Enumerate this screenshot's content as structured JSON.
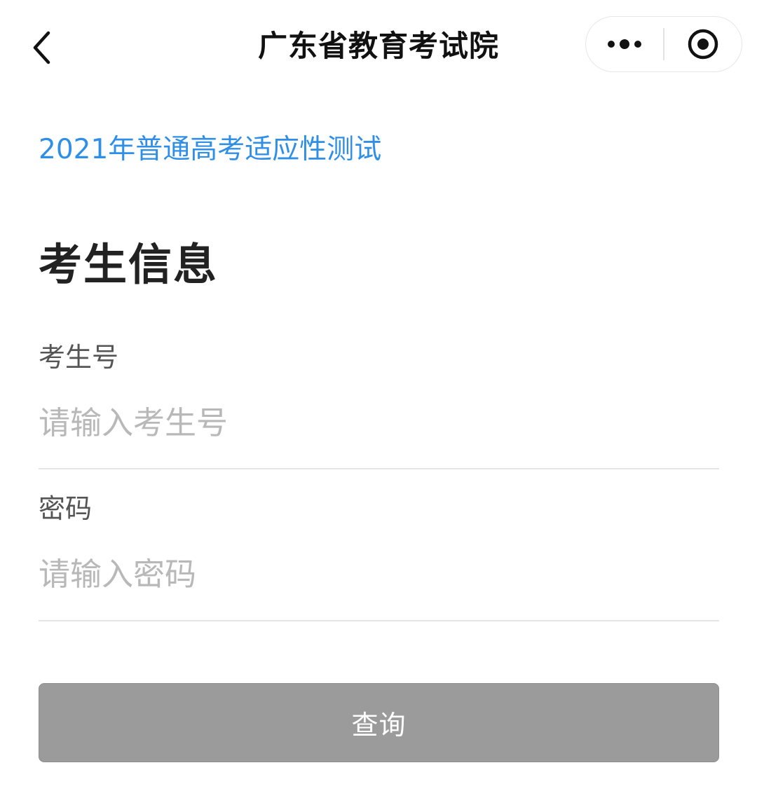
{
  "navbar": {
    "title": "广东省教育考试院",
    "icons": {
      "back": "chevron-left-icon",
      "more": "more-dots-icon",
      "close": "target-close-icon"
    }
  },
  "content": {
    "exam_link": "2021年普通高考适应性测试",
    "section_title": "考生信息",
    "fields": [
      {
        "label": "考生号",
        "value": "",
        "placeholder": "请输入考生号"
      },
      {
        "label": "密码",
        "value": "",
        "placeholder": "请输入密码"
      }
    ],
    "submit_label": "查询"
  },
  "colors": {
    "link": "#2f8fe6",
    "button_disabled": "#9b9b9b",
    "placeholder": "#b8b8b8",
    "divider": "#e4e4e4"
  }
}
